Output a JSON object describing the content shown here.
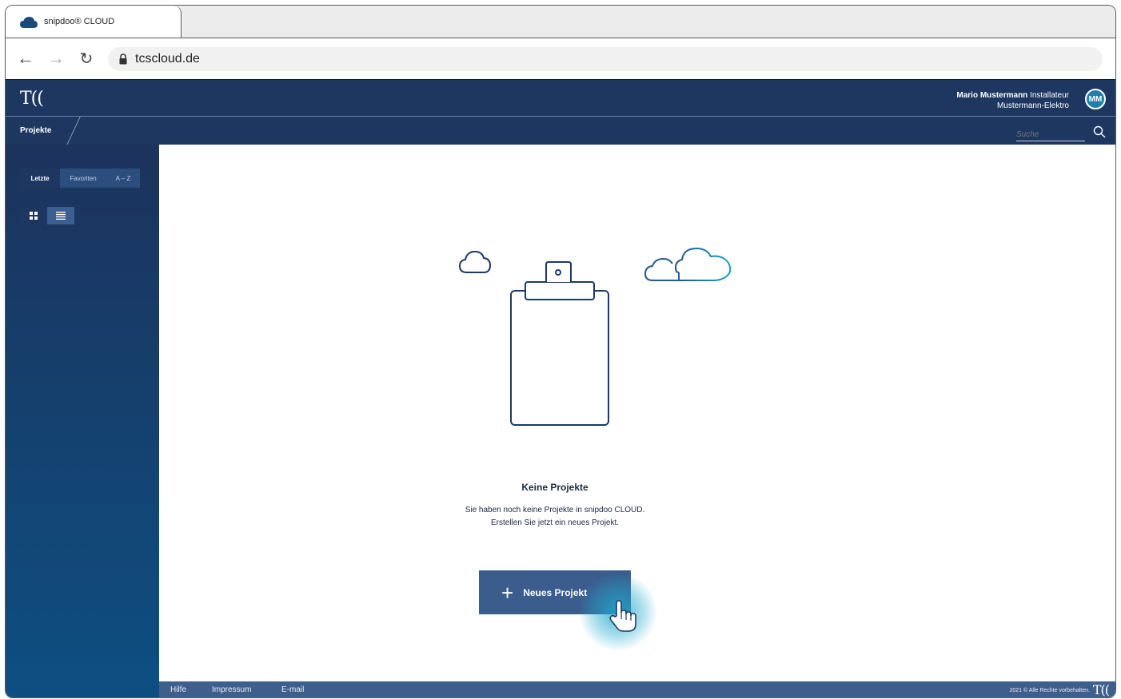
{
  "browser": {
    "tab_title": "snipdoo® CLOUD",
    "url": "tcscloud.de"
  },
  "header": {
    "logo": "T((",
    "user_name": "Mario Mustermann",
    "user_role": "Installateur",
    "company": "Mustermann-Elektro",
    "avatar_initials": "MM"
  },
  "subnav": {
    "item": "Projekte",
    "search_placeholder": "Suche"
  },
  "sidebar": {
    "segments": [
      "Letzte",
      "Favoriten",
      "A – Z"
    ],
    "active_segment": "Letzte",
    "view_modes": [
      "grid-icon",
      "list-icon"
    ],
    "active_view": "grid-icon"
  },
  "main": {
    "empty_title": "Keine Projekte",
    "empty_line1": "Sie haben noch keine Projekte in snipdoo CLOUD.",
    "empty_line2": "Erstellen Sie jetzt ein neues Projekt.",
    "new_project_label": "Neues Projekt"
  },
  "footer": {
    "links": [
      "Hilfe",
      "Impressum",
      "E-mail"
    ],
    "copyright": "2021 © Alle Rechte vorbehalten.",
    "logo": "T(("
  },
  "colors": {
    "header": "#1e3760",
    "accent": "#1faacd",
    "button": "#3a5d8e"
  }
}
